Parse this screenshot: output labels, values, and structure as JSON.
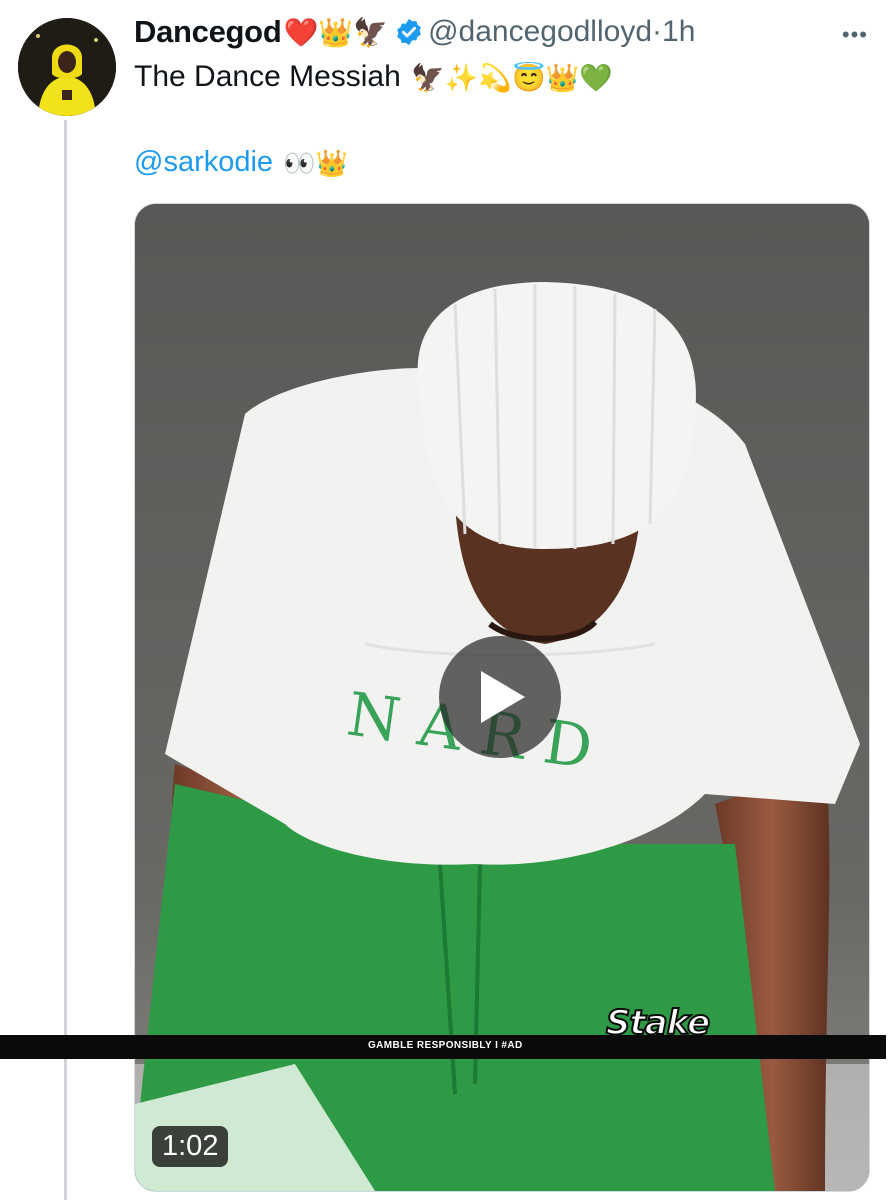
{
  "tweet": {
    "display_name": "Dancegod",
    "name_emojis": "❤️👑🦅",
    "handle": "@dancegodlloyd",
    "separator": "·",
    "time": "1h",
    "more_label": "•••",
    "bio_text": "The Dance Messiah",
    "bio_emojis": "🦅✨💫😇👑💚",
    "mention": "@sarkodie",
    "mention_emojis": "👀👑"
  },
  "video": {
    "duration": "1:02",
    "ad_text": "GAMBLE RESPONSIBLY  I  #AD",
    "ad_brand": "Stake"
  },
  "colors": {
    "link": "#1d9bf0",
    "secondary_text": "#536471",
    "verified_badge": "#1d9bf0",
    "shirt_print": "#3aa35a",
    "shorts": "#2f9a45"
  },
  "icons": [
    "verified-badge-icon",
    "more-icon",
    "play-icon"
  ]
}
